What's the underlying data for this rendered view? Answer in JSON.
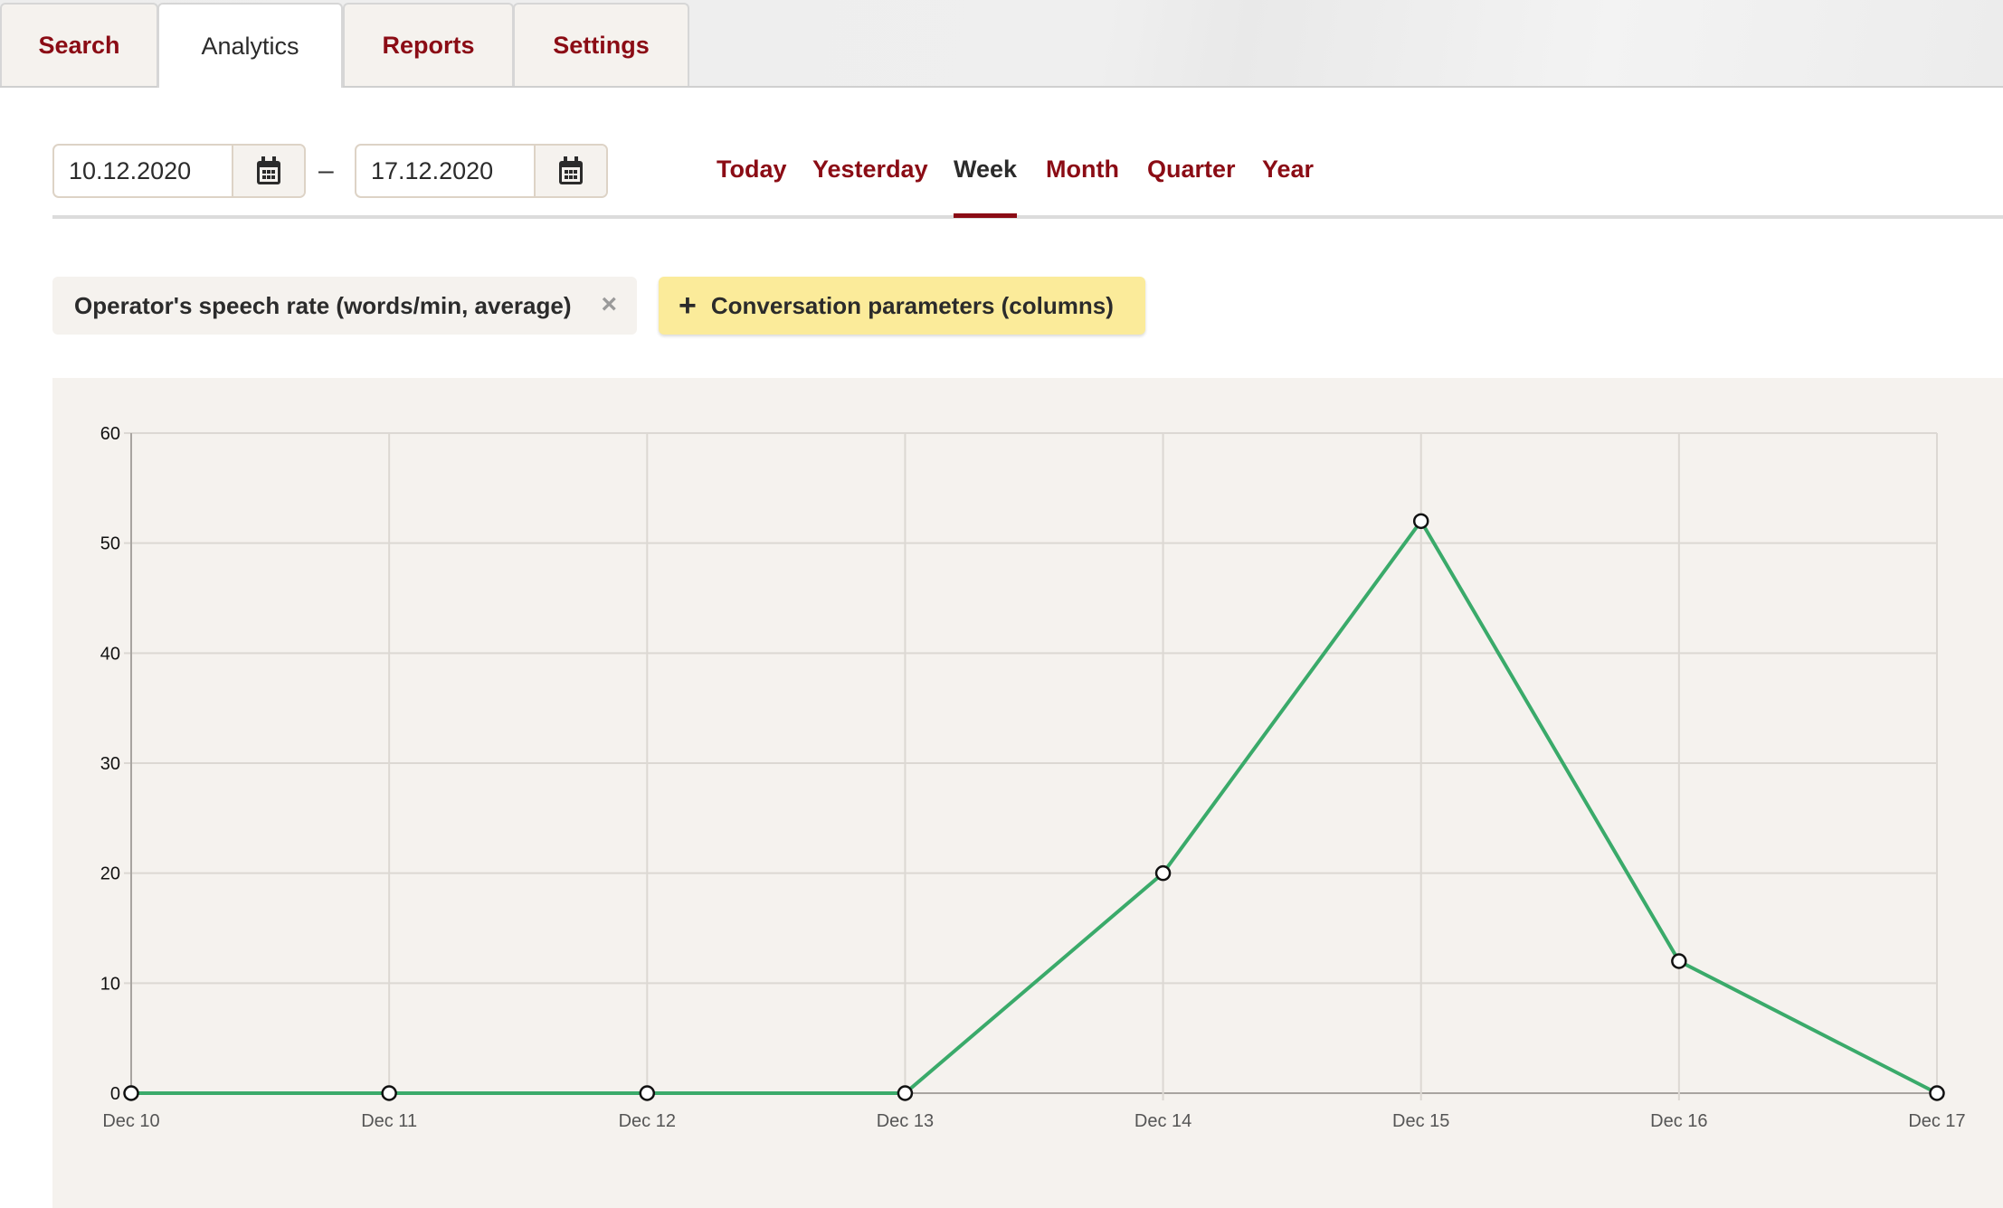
{
  "tabs": [
    {
      "label": "Search",
      "active": false
    },
    {
      "label": "Analytics",
      "active": true
    },
    {
      "label": "Reports",
      "active": false
    },
    {
      "label": "Settings",
      "active": false
    }
  ],
  "date_range": {
    "from": "10.12.2020",
    "separator": "–",
    "to": "17.12.2020",
    "calendar_icon": "calendar-icon"
  },
  "periods": [
    {
      "label": "Today",
      "active": false
    },
    {
      "label": "Yesterday",
      "active": false
    },
    {
      "label": "Week",
      "active": true
    },
    {
      "label": "Month",
      "active": false
    },
    {
      "label": "Quarter",
      "active": false
    },
    {
      "label": "Year",
      "active": false
    }
  ],
  "filter_chip": {
    "label": "Operator's speech rate (words/min, average)",
    "remove_icon": "close-icon",
    "remove_glyph": "×"
  },
  "add_button": {
    "icon": "plus-icon",
    "glyph": "+",
    "label": "Conversation parameters (columns)"
  },
  "colors": {
    "accent": "#8b0c15",
    "series_line": "#3aaa6a",
    "add_button_bg": "#fbeb9a",
    "panel_bg": "#f5f2ee"
  },
  "chart_data": {
    "type": "line",
    "title": "",
    "xlabel": "",
    "ylabel": "",
    "categories": [
      "Dec 10",
      "Dec 11",
      "Dec 12",
      "Dec 13",
      "Dec 14",
      "Dec 15",
      "Dec 16",
      "Dec 17"
    ],
    "series": [
      {
        "name": "Operator's speech rate (words/min, average)",
        "values": [
          0,
          0,
          0,
          0,
          20,
          52,
          12,
          0
        ],
        "color": "#3aaa6a"
      }
    ],
    "ylim": [
      0,
      60
    ],
    "yticks": [
      0,
      10,
      20,
      30,
      40,
      50,
      60
    ],
    "grid": true,
    "legend": "none"
  }
}
